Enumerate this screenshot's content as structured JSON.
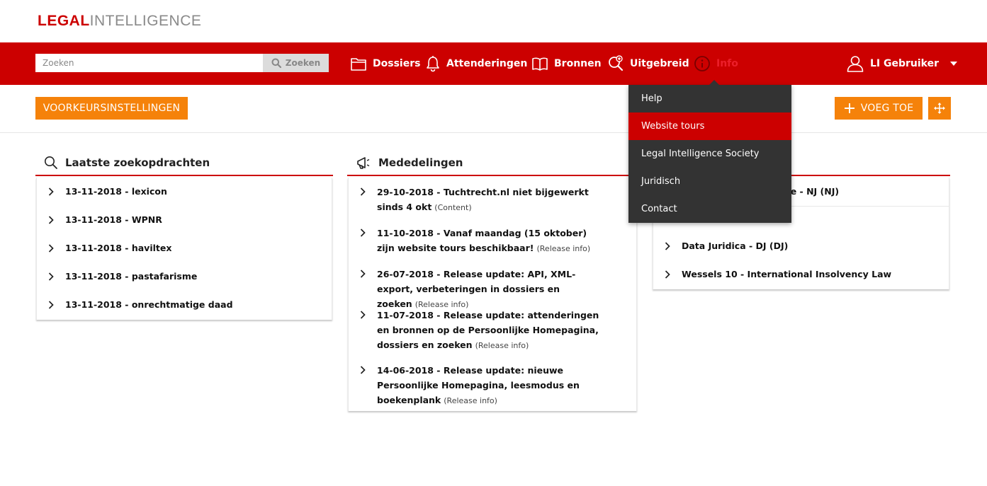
{
  "logo": {
    "part1": "LEGAL",
    "part2": "INTELLIGENCE"
  },
  "search": {
    "placeholder": "Zoeken",
    "button_label": "Zoeken"
  },
  "nav": {
    "items": [
      {
        "label": "Dossiers",
        "icon": "folder-icon"
      },
      {
        "label": "Attenderingen",
        "icon": "bell-icon"
      },
      {
        "label": "Bronnen",
        "icon": "book-icon"
      },
      {
        "label": "Uitgebreid",
        "icon": "advanced-search-icon"
      },
      {
        "label": "Info",
        "icon": "info-icon"
      }
    ],
    "user_label": "LI Gebruiker"
  },
  "toolbar": {
    "preferences_label": "VOORKEURSINSTELLINGEN",
    "add_label": "VOEG TOE"
  },
  "recent_searches": {
    "title": "Laatste zoekopdrachten",
    "items": [
      "13-11-2018 - lexicon",
      "13-11-2018 - WPNR",
      "13-11-2018 - haviltex",
      "13-11-2018 - pastafarisme",
      "13-11-2018 - onrechtmatige daad"
    ]
  },
  "announcements": {
    "title": "Mededelingen",
    "items": [
      {
        "title": "29-10-2018 - Tuchtrecht.nl niet bijgewerkt sinds 4 okt",
        "note": "(Content)"
      },
      {
        "title": "11-10-2018 - Vanaf maandag (15 oktober) zijn website tours beschikbaar!",
        "note": "(Release info)"
      },
      {
        "title": "26-07-2018 - Release update: API, XML-export, verbeteringen in dossiers en zoeken",
        "note": "(Release info)"
      },
      {
        "title": "11-07-2018 - Release update: attenderingen en bronnen op de Persoonlijke Homepagina, dossiers en zoeken",
        "note": "(Release info)"
      },
      {
        "title": "14-06-2018 - Release update: nieuwe Persoonlijke Homepagina, leesmodus en boekenplank",
        "note": "(Release info)"
      }
    ]
  },
  "sources": {
    "partial_item": "atie - NJ (NJ)",
    "items": [
      "Data Juridica - DJ (DJ)",
      "Wessels 10 - International Insolvency Law"
    ]
  },
  "info_menu": {
    "items": [
      "Help",
      "Website tours",
      "Legal Intelligence Society",
      "Juridisch",
      "Contact"
    ],
    "active_index": 1
  },
  "colors": {
    "brand_red": "#cc0000",
    "accent_orange": "#f5820a",
    "dropdown_bg": "#333333"
  }
}
